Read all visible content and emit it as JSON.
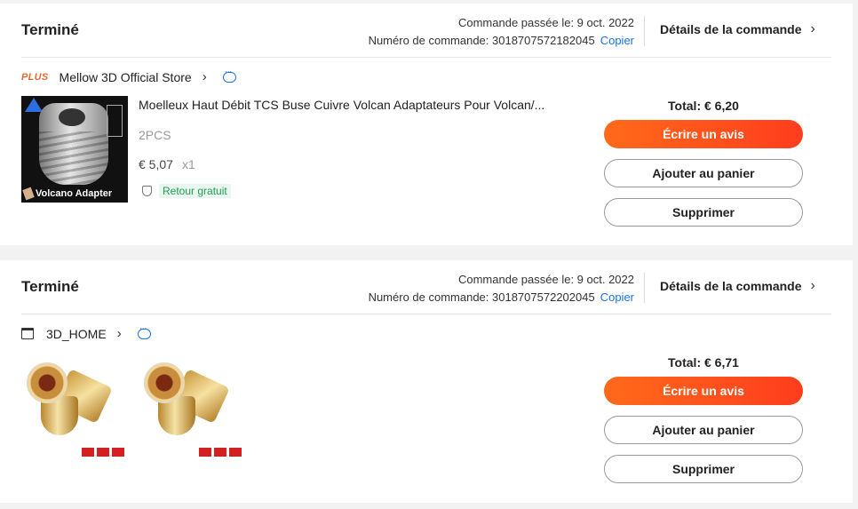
{
  "orders": [
    {
      "status": "Terminé",
      "date_text": "Commande passée le: 9 oct. 2022",
      "number_text": "Numéro de commande: 3018707572182045",
      "copy_label": "Copier",
      "details_label": "Détails de la commande",
      "store_badge": "PLUS",
      "store_name": "Mellow 3D Official Store",
      "product_title": "Moelleux Haut Débit TCS Buse Cuivre Volcan Adaptateurs Pour Volcan/...",
      "image_caption": "Volcano Adapter",
      "variant": "2PCS",
      "price": "€ 5,07",
      "quantity": "x1",
      "return_label": "Retour gratuit",
      "total": "Total: € 6,20",
      "review_label": "Écrire un avis",
      "cart_label": "Ajouter au panier",
      "delete_label": "Supprimer"
    },
    {
      "status": "Terminé",
      "date_text": "Commande passée le: 9 oct. 2022",
      "number_text": "Numéro de commande: 3018707572202045",
      "copy_label": "Copier",
      "details_label": "Détails de la commande",
      "store_name": "3D_HOME",
      "total": "Total: € 6,71",
      "review_label": "Écrire un avis",
      "cart_label": "Ajouter au panier",
      "delete_label": "Supprimer"
    }
  ],
  "icons": {
    "chevron": "chevron-right-icon",
    "chat": "chat-icon",
    "store": "store-icon",
    "shield": "shield-icon"
  },
  "colors": {
    "primary_button": "#ff4a1c",
    "link": "#1a73e8",
    "return_badge_text": "#1f9d55",
    "plus_badge": "#e36a2e"
  }
}
